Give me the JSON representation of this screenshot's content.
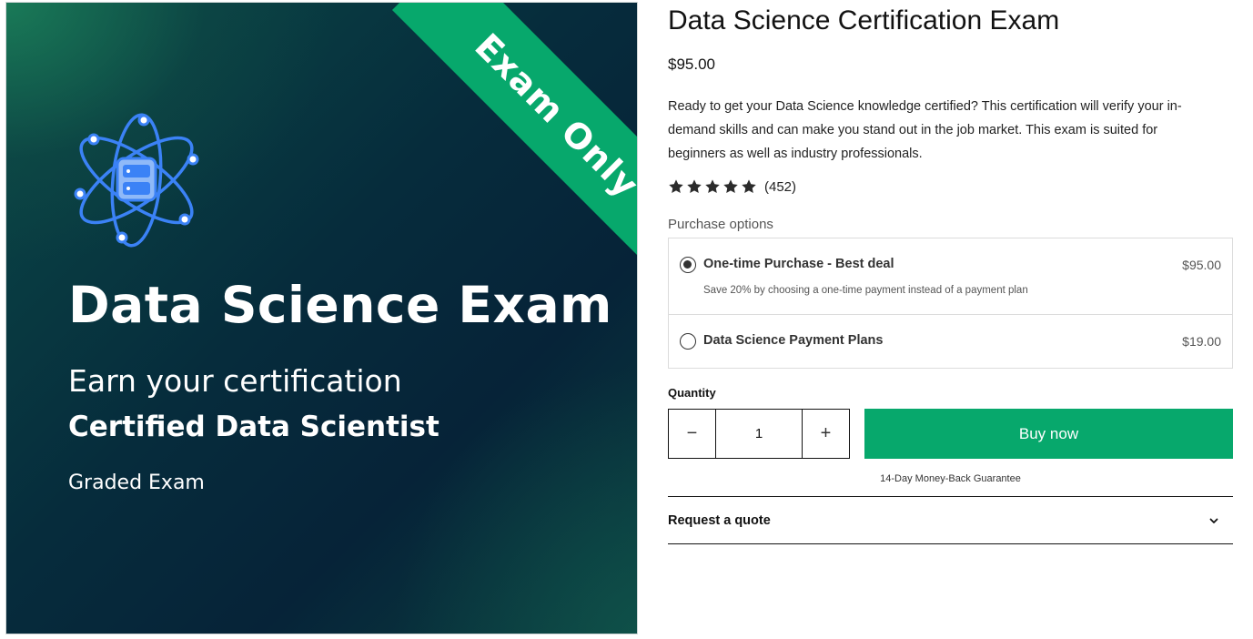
{
  "hero": {
    "ribbon": "Exam Only",
    "title": "Data Science Exam",
    "subtitle": "Earn your certification",
    "certification": "Certified Data Scientist",
    "type": "Graded Exam",
    "icon": "atom-server-icon"
  },
  "product": {
    "title": "Data Science Certification Exam",
    "price": "$95.00",
    "description": "Ready to get your Data Science knowledge certified? This certification will verify your in-demand skills and can make you stand out in the job market. This exam is suited for beginners as well as industry professionals.",
    "rating": {
      "stars": 5,
      "count": "(452)"
    }
  },
  "purchase": {
    "label": "Purchase options",
    "options": [
      {
        "name": "One-time Purchase - Best deal",
        "price": "$95.00",
        "note": "Save 20% by choosing a one-time payment instead of a payment plan",
        "selected": true
      },
      {
        "name": "Data Science Payment Plans",
        "price": "$19.00",
        "selected": false
      }
    ]
  },
  "quantity": {
    "label": "Quantity",
    "value": "1",
    "minus": "−",
    "plus": "+"
  },
  "buy_label": "Buy now",
  "guarantee": "14-Day Money-Back Guarantee",
  "quote_label": "Request a quote",
  "colors": {
    "accent": "#07a86c",
    "hero_dark": "#062c3c",
    "icon_blue": "#3b82f6"
  }
}
